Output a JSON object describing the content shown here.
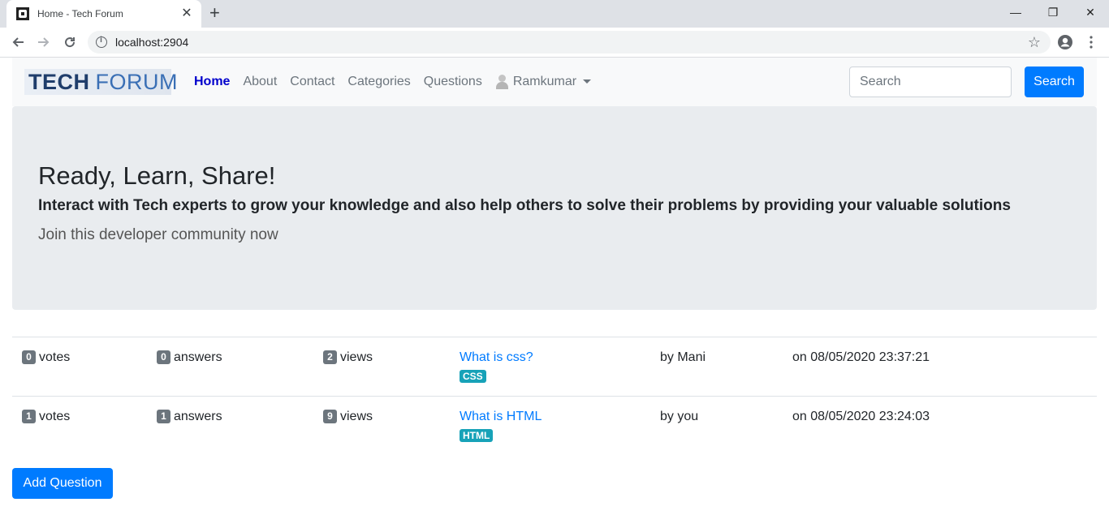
{
  "browser": {
    "tab_title": "Home - Tech Forum",
    "tab_close": "✕",
    "new_tab": "+",
    "url": "localhost:2904",
    "controls": {
      "minimize": "—",
      "restore": "❐",
      "close": "✕"
    }
  },
  "navbar": {
    "brand_bold": "TECH",
    "brand_light": "FORUM",
    "links": [
      {
        "label": "Home",
        "active": true
      },
      {
        "label": "About"
      },
      {
        "label": "Contact"
      },
      {
        "label": "Categories"
      },
      {
        "label": "Questions"
      }
    ],
    "user": "Ramkumar",
    "search_placeholder": "Search",
    "search_button": "Search"
  },
  "hero": {
    "title": "Ready, Learn, Share!",
    "subtitle": "Interact with Tech experts to grow your knowledge and also help others to solve their problems by providing your valuable solutions",
    "lead": "Join this developer community now"
  },
  "questions": [
    {
      "votes": "0",
      "votes_label": "votes",
      "answers": "0",
      "answers_label": "answers",
      "views": "2",
      "views_label": "views",
      "title": "What is css?",
      "tag": "CSS",
      "author": "by Mani",
      "date": "on 08/05/2020 23:37:21"
    },
    {
      "votes": "1",
      "votes_label": "votes",
      "answers": "1",
      "answers_label": "answers",
      "views": "9",
      "views_label": "views",
      "title": "What is HTML",
      "tag": "HTML",
      "author": "by you",
      "date": "on 08/05/2020 23:24:03"
    }
  ],
  "add_question_label": "Add Question",
  "colors": {
    "primary": "#007bff",
    "info": "#17a2b8",
    "secondary": "#6c757d",
    "jumbotron": "#e9ecef",
    "navbar": "#f8f9fa"
  }
}
